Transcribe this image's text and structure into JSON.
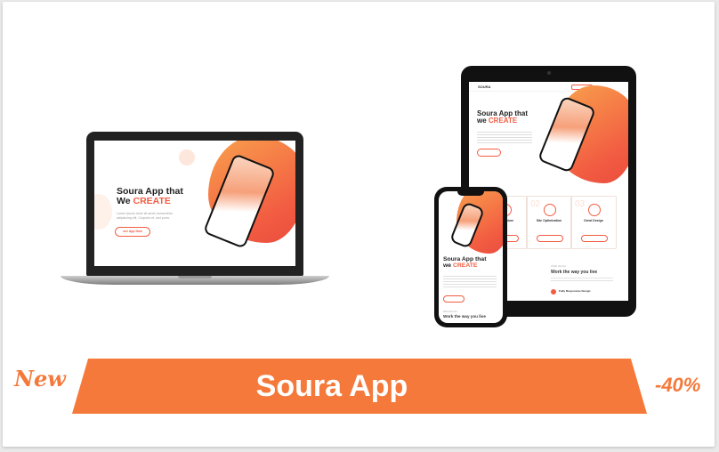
{
  "banner": {
    "title": "Soura App",
    "new_label": "New",
    "discount": "-40%"
  },
  "laptop": {
    "headline_line1": "Soura App that",
    "headline_we": "We",
    "headline_accent": "CREATE",
    "body_text": "Lorem ipsum dolor sit amet consectetur adipisicing elit. Corporis et, sed porro.",
    "button_label": "see App Now"
  },
  "tablet": {
    "brand": "SOURA",
    "headline_line1": "Soura App that",
    "headline_we": "we",
    "headline_accent": "CREATE",
    "features": [
      "App Feature",
      "Site Optimization",
      "Great Design"
    ],
    "numbers": [
      "02",
      "03"
    ],
    "section_kicker": "What We Do",
    "section_title": "Work the way you live",
    "item_title": "Fully Responsive Design"
  },
  "phone": {
    "headline_line1": "Soura App that",
    "headline_we": "we",
    "headline_accent": "CREATE",
    "kicker": "What We Do",
    "section_title": "Work the way you live"
  },
  "colors": {
    "accent": "#f5793a",
    "accent_red": "#f25d42",
    "device": "#111111"
  }
}
